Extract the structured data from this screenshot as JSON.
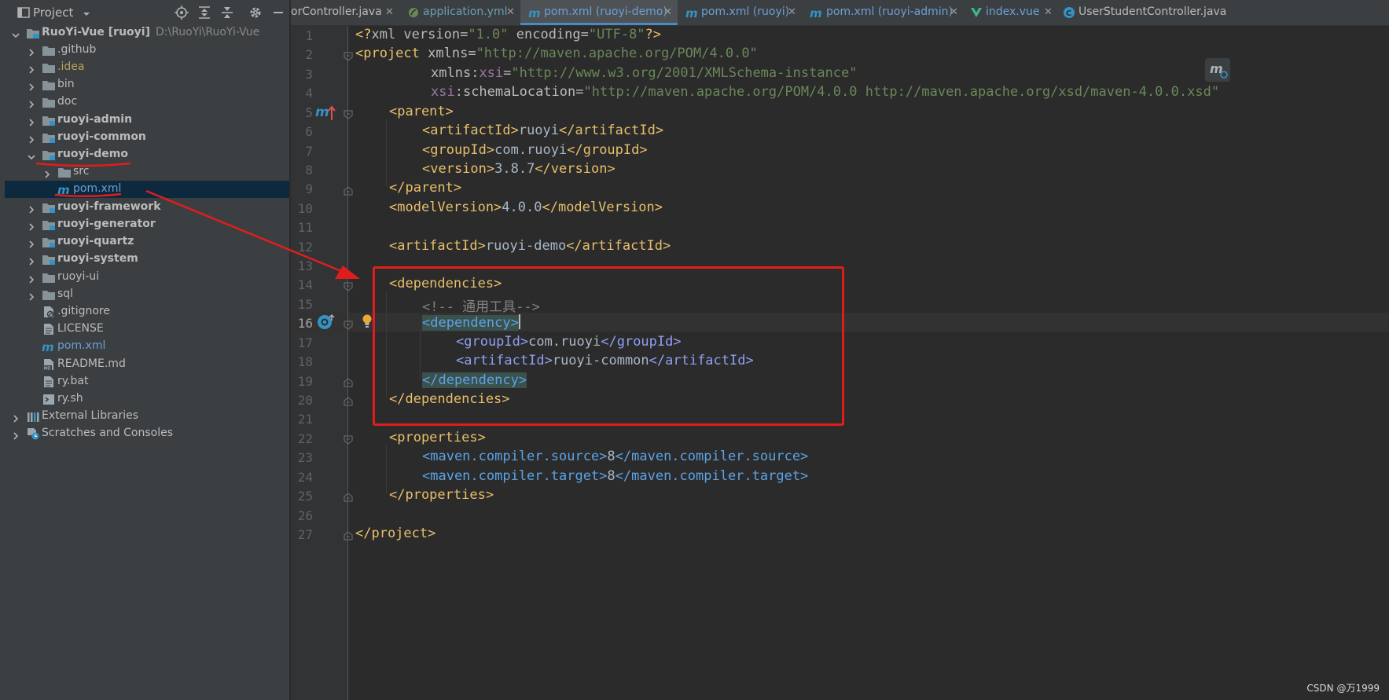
{
  "project_panel": {
    "title": "Project",
    "tree": [
      {
        "label": "RuoYi-Vue [ruoyi]",
        "path": "D:\\RuoYi\\RuoYi-Vue",
        "type": "module-root",
        "expanded": true
      },
      {
        "label": ".github",
        "type": "folder"
      },
      {
        "label": ".idea",
        "type": "folder-idea"
      },
      {
        "label": "bin",
        "type": "folder"
      },
      {
        "label": "doc",
        "type": "folder"
      },
      {
        "label": "ruoyi-admin",
        "type": "module-folder"
      },
      {
        "label": "ruoyi-common",
        "type": "module-folder"
      },
      {
        "label": "ruoyi-demo",
        "type": "module-folder",
        "expanded": true
      },
      {
        "label": "src",
        "type": "folder"
      },
      {
        "label": "pom.xml",
        "type": "maven-file",
        "selected": true
      },
      {
        "label": "ruoyi-framework",
        "type": "module-folder"
      },
      {
        "label": "ruoyi-generator",
        "type": "module-folder"
      },
      {
        "label": "ruoyi-quartz",
        "type": "module-folder"
      },
      {
        "label": "ruoyi-system",
        "type": "module-folder"
      },
      {
        "label": "ruoyi-ui",
        "type": "folder"
      },
      {
        "label": "sql",
        "type": "folder"
      },
      {
        "label": ".gitignore",
        "type": "file-ignore"
      },
      {
        "label": "LICENSE",
        "type": "file-text"
      },
      {
        "label": "pom.xml",
        "type": "maven-file"
      },
      {
        "label": "README.md",
        "type": "file-md"
      },
      {
        "label": "ry.bat",
        "type": "file-text"
      },
      {
        "label": "ry.sh",
        "type": "file-shell"
      },
      {
        "label": "External Libraries",
        "type": "libraries"
      },
      {
        "label": "Scratches and Consoles",
        "type": "scratches"
      }
    ]
  },
  "tabs": [
    {
      "label": "orController.java",
      "icon": "java-class-icon",
      "closable": true
    },
    {
      "label": "application.yml",
      "icon": "yaml-icon",
      "closable": true
    },
    {
      "label": "pom.xml (ruoyi-demo)",
      "icon": "maven-icon",
      "closable": true,
      "active": true
    },
    {
      "label": "pom.xml (ruoyi)",
      "icon": "maven-icon",
      "closable": true
    },
    {
      "label": "pom.xml (ruoyi-admin)",
      "icon": "maven-icon",
      "closable": true
    },
    {
      "label": "index.vue",
      "icon": "vue-icon",
      "closable": true
    },
    {
      "label": "UserStudentController.java",
      "icon": "java-class-icon",
      "closable": false
    }
  ],
  "editor": {
    "current_line": 16,
    "line_numbers": [
      "1",
      "2",
      "3",
      "4",
      "5",
      "6",
      "7",
      "8",
      "9",
      "10",
      "11",
      "12",
      "13",
      "14",
      "15",
      "16",
      "17",
      "18",
      "19",
      "20",
      "21",
      "22",
      "23",
      "24",
      "25",
      "26",
      "27"
    ],
    "lines": {
      "l1": {
        "a": "<?",
        "b": "xml version",
        "c": "=",
        "d": "\"1.0\"",
        "e": " encoding",
        "f": "=",
        "g": "\"UTF-8\"",
        "h": "?>"
      },
      "l2": {
        "a": "<project ",
        "b": "xmlns",
        "c": "=",
        "d": "\"http://maven.apache.org/POM/4.0.0\""
      },
      "l3": {
        "a": "xmlns",
        "b": ":",
        "c": "xsi",
        "d": "=",
        "e": "\"http://www.w3.org/2001/XMLSchema-instance\""
      },
      "l4": {
        "a": "xsi",
        "b": ":schemaLocation",
        "c": "=",
        "d": "\"http://maven.apache.org/POM/4.0.0 http://maven.apache.org/xsd/maven-4.0.0.xsd\""
      },
      "l5": {
        "a": "<parent>"
      },
      "l6": {
        "a": "<artifactId>",
        "b": "ruoyi",
        "c": "</artifactId>"
      },
      "l7": {
        "a": "<groupId>",
        "b": "com.ruoyi",
        "c": "</groupId>"
      },
      "l8": {
        "a": "<version>",
        "b": "3.8.7",
        "c": "</version>"
      },
      "l9": {
        "a": "</parent>"
      },
      "l10": {
        "a": "<modelVersion>",
        "b": "4.0.0",
        "c": "</modelVersion>"
      },
      "l12": {
        "a": "<artifactId>",
        "b": "ruoyi-demo",
        "c": "</artifactId>"
      },
      "l14": {
        "a": "<dependencies>"
      },
      "l15": {
        "a": "<!-- 通用工具-->"
      },
      "l16": {
        "a": "<dependency>"
      },
      "l17": {
        "a": "<groupId>",
        "b": "com.ruoyi",
        "c": "</groupId>"
      },
      "l18": {
        "a": "<artifactId>",
        "b": "ruoyi-common",
        "c": "</artifactId>"
      },
      "l19": {
        "a": "</dependency>"
      },
      "l20": {
        "a": "</dependencies>"
      },
      "l22": {
        "a": "<properties>"
      },
      "l23": {
        "a": "<maven.compiler.source>",
        "b": "8",
        "c": "</maven.compiler.source>"
      },
      "l24": {
        "a": "<maven.compiler.target>",
        "b": "8",
        "c": "</maven.compiler.target>"
      },
      "l25": {
        "a": "</properties>"
      },
      "l27": {
        "a": "</project>"
      }
    }
  },
  "watermark": "CSDN @万1999",
  "colors": {
    "background": "#2b2b2b",
    "panel": "#3c3f41",
    "selection": "#0d293e",
    "annotation_red": "#e01d1d",
    "tag": "#e8bf6a",
    "string": "#6a8759",
    "active_tab_underline": "#4a88c7"
  }
}
